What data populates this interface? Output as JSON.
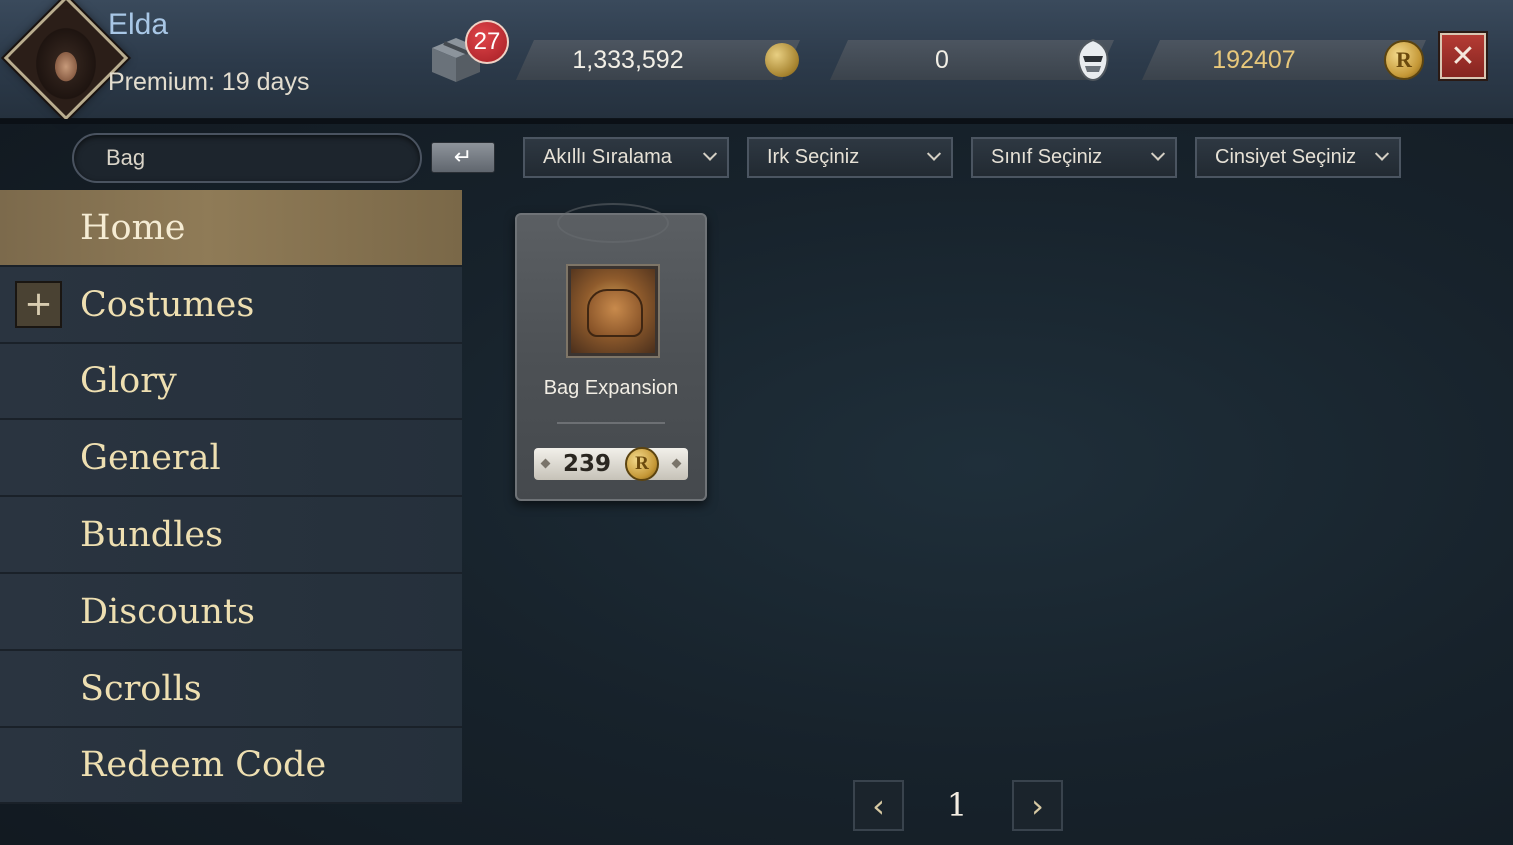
{
  "player": {
    "name": "Elda",
    "premium": "Premium: 19 days"
  },
  "notifications": {
    "gift_count": "27"
  },
  "currencies": {
    "gold": "1,333,592",
    "mask": "0",
    "r_points": "192407",
    "r_symbol": "R"
  },
  "search": {
    "value": "Bag",
    "enter_symbol": "↵"
  },
  "filters": [
    {
      "label": "Akıllı Sıralama"
    },
    {
      "label": "Irk Seçiniz"
    },
    {
      "label": "Sınıf Seçiniz"
    },
    {
      "label": "Cinsiyet Seçiniz"
    }
  ],
  "sidebar": {
    "items": [
      {
        "label": "Home"
      },
      {
        "label": "Costumes"
      },
      {
        "label": "Glory"
      },
      {
        "label": "General"
      },
      {
        "label": "Bundles"
      },
      {
        "label": "Discounts"
      },
      {
        "label": "Scrolls"
      },
      {
        "label": "Redeem Code"
      }
    ],
    "expand_symbol": "+"
  },
  "products": [
    {
      "name": "Bag Expansion",
      "price": "239",
      "currency_symbol": "R"
    }
  ],
  "pagination": {
    "page": "1",
    "prev_symbol": "‹",
    "next_symbol": "›"
  },
  "close_symbol": "✕",
  "colors": {
    "accent_gold": "#eedfb1",
    "active_nav": "#8f7b57",
    "close_red": "#b53b34",
    "badge_red": "#c52c31"
  }
}
